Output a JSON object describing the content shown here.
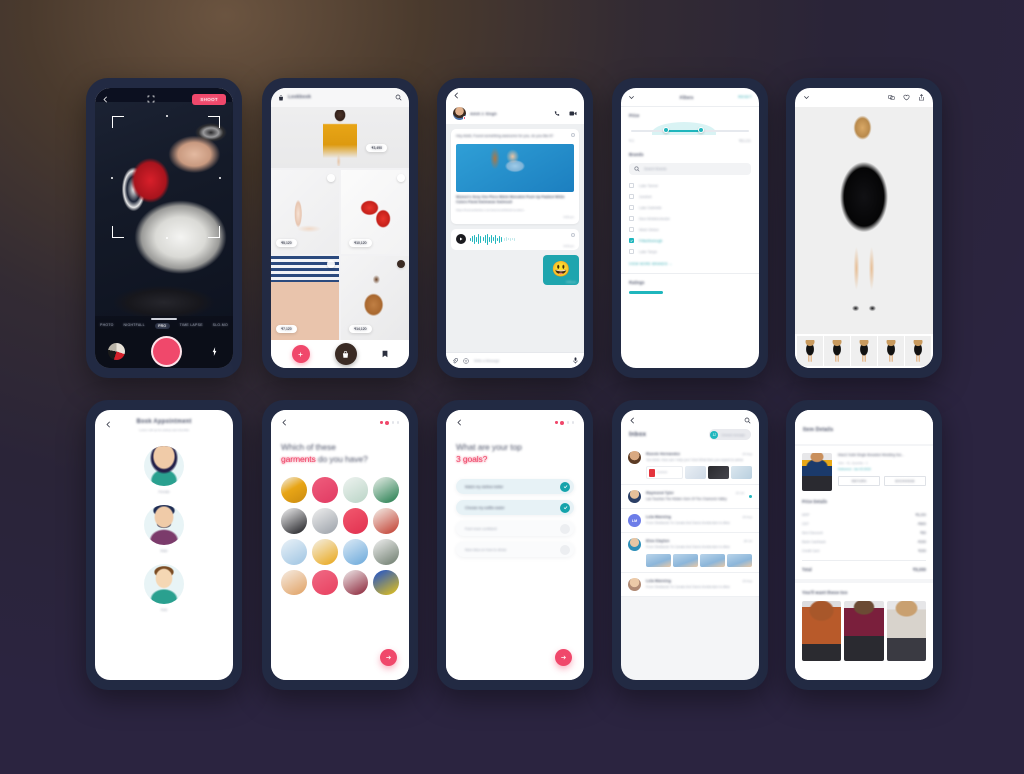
{
  "camera": {
    "shoot_label": "SHOOT",
    "modes": [
      "PHOTO",
      "NIGHTFALL",
      "PRO",
      "TIME LAPSE",
      "SLO-MO"
    ],
    "active_mode": "PRO",
    "icons": {
      "back": "back-arrow-icon",
      "scan": "scan-frame-icon",
      "thumb": "gallery-thumbnail",
      "shutter": "shutter-button",
      "flash": "flash-icon"
    }
  },
  "lookbook": {
    "title": "Lookbook",
    "hero_price": "₹3,490",
    "items": [
      {
        "price": "₹5,120",
        "style": "im-heels"
      },
      {
        "price": "₹10,120",
        "style": "im-red"
      },
      {
        "price": "₹7,120",
        "style": "im-short"
      },
      {
        "price": "₹14,120",
        "style": "im-coat"
      }
    ],
    "footer": {
      "add": "add-icon",
      "bag": "shopping-bag-icon",
      "saved": "saved-items-icon"
    }
  },
  "chat": {
    "contact": "Advit J. Singh",
    "message": "Hey Advit, Found something awesome for you, do you like it?",
    "product_title": "Women's Sexy One Piece Bikini Monokini Push Up Padded White Colors Floral Swimwear Swimsuit",
    "product_url": "https://hotmaxfashion.com/womens/bikini/monokini...",
    "msg_time": "9:50 pm",
    "voice_time": "9:53 pm",
    "sticker_time": "9:55 pm",
    "sticker_emoji": "😃",
    "input_placeholder": "Write a Message"
  },
  "filters": {
    "title": "Filters",
    "reset": "RESET",
    "price_label": "Price",
    "price_min": "₹ 0",
    "price_max": "₹52,221",
    "brands_label": "Brands",
    "search_placeholder": "Search Brands",
    "brands": [
      {
        "name": "Lake Tanner",
        "checked": false
      },
      {
        "name": "Jonefurt",
        "checked": false
      },
      {
        "name": "Lake Gabrielle",
        "checked": false
      },
      {
        "name": "New Wnkkinchester",
        "checked": false
      },
      {
        "name": "West Clinton",
        "checked": false
      },
      {
        "name": "Fritschborough",
        "checked": true
      },
      {
        "name": "Lake Tanya",
        "checked": false
      }
    ],
    "view_more": "VIEW MORE BRANDS  →",
    "ratings_label": "Ratings"
  },
  "product": {
    "icons": {
      "down": "chevron-down-icon",
      "compare": "compare-icon",
      "wishlist": "heart-icon",
      "share": "share-icon"
    },
    "thumb_count": 5
  },
  "appointment": {
    "title": "Book Appointment",
    "subtitle": "Lorem will up for pickup and shortlist",
    "options": [
      {
        "label": "Female",
        "style": "f"
      },
      {
        "label": "Male",
        "style": "m"
      },
      {
        "label": "Kids",
        "style": "k"
      }
    ]
  },
  "garments": {
    "question_1": "Which of these",
    "question_hl": "garments",
    "question_2": "do you have?",
    "tile_count": 16,
    "tiles": [
      "linear-gradient(150deg,#f0f0f0 0%,#e8a516 45%,#c98a10 100%)",
      "linear-gradient(150deg,#ef5d7d 0%,#e13a62 100%)",
      "linear-gradient(150deg,#eef3f0 0%,#b9d4c6 100%)",
      "linear-gradient(150deg,#e9efe9 0%,#1f7a4a 100%)",
      "linear-gradient(150deg,#f2f2f3 0%,#1a1a1e 100%)",
      "linear-gradient(150deg,#efefef 0%,#9aa0a8 100%)",
      "linear-gradient(150deg,#f2596f 0%,#e1304f 100%)",
      "linear-gradient(150deg,#f4efe9 0%,#c0392b 100%)",
      "linear-gradient(150deg,#eaf2f8 0%,#9ec4e2 100%)",
      "linear-gradient(150deg,#f5f0e4 0%,#e8a516 100%)",
      "linear-gradient(150deg,#dceaf6 0%,#6aa8da 100%)",
      "linear-gradient(150deg,#f0f0f0 0%,#6b7a6b 100%)",
      "linear-gradient(150deg,#f6ece2 0%,#e0a062 100%)",
      "linear-gradient(150deg,#f06a85 0%,#e8405f 100%)",
      "linear-gradient(150deg,#efe9ea 0%,#8a2236 100%)",
      "linear-gradient(150deg,#1a4fd0 0%,#e8c416 100%)"
    ]
  },
  "goals": {
    "question_1": "What are your top",
    "question_hl": "3 goals?",
    "options": [
      {
        "label": "Match my clothes better",
        "selected": true
      },
      {
        "label": "Choose my outfits easier",
        "selected": true
      },
      {
        "label": "Feel more confident",
        "selected": false
      },
      {
        "label": "New idea on how to dress",
        "selected": false
      }
    ]
  },
  "inbox": {
    "title": "Inbox",
    "unread_count": "12",
    "unread_label": "Unread message",
    "threads": [
      {
        "name": "Roovie Hernandez",
        "date": "24 Aug",
        "preview": "Yes Advit, How can I help you? And What time you expect to arrive",
        "avatar": "av1",
        "initials": "",
        "attach": "files",
        "attach_name": "Contract",
        "unread": false
      },
      {
        "name": "Raymond Tyler",
        "date": "23 Jul",
        "preview": "Les Touches The Hidden Gem Of The Chamonix Valley",
        "avatar": "av2",
        "initials": "",
        "attach": "none",
        "unread": true
      },
      {
        "name": "Lela Manning",
        "date": "18 Aug",
        "preview": "From Shetlands To Canals And Dams Amsterdam Is Alive",
        "avatar": "av3",
        "initials": "LM",
        "attach": "none",
        "unread": false
      },
      {
        "name": "Elva Clayton",
        "date": "28 Jul",
        "preview": "From Shetlands To Canals And Dams Amsterdam Is Alive",
        "avatar": "av4",
        "initials": "",
        "attach": "photos",
        "unread": false
      },
      {
        "name": "Lela Manning",
        "date": "18 Aug",
        "preview": "From Shetlands To Canals And Dams Amsterdam Is Alive",
        "avatar": "av5",
        "initials": "",
        "attach": "none",
        "unread": false
      }
    ]
  },
  "item_details": {
    "title": "Item Details",
    "product_name": "Marc2 Solid Single Breasted Wedding Sui...",
    "meta": "Size : 41,  Quantity : 1",
    "delivered": "Delivered : Jan 03 2019",
    "btn_return": "RETURN",
    "btn_exchange": "EXCHANGE",
    "price_heading": "Price Details",
    "price_rows": [
      {
        "label": "MRP",
        "value": "₹5,200"
      },
      {
        "label": "GST",
        "value": "-₹800"
      },
      {
        "label": "Item Discount",
        "value": "₹50"
      },
      {
        "label": "Bank Cashback",
        "value": "-₹200"
      },
      {
        "label": "Credit Card",
        "value": "₹200"
      }
    ],
    "total_label": "Total",
    "total_value": "₹5,000",
    "suggest_heading": "You'll want these too"
  },
  "colors": {
    "accent_pink": "#f0486b",
    "accent_teal": "#1fb6bd",
    "frame": "#222a43"
  }
}
